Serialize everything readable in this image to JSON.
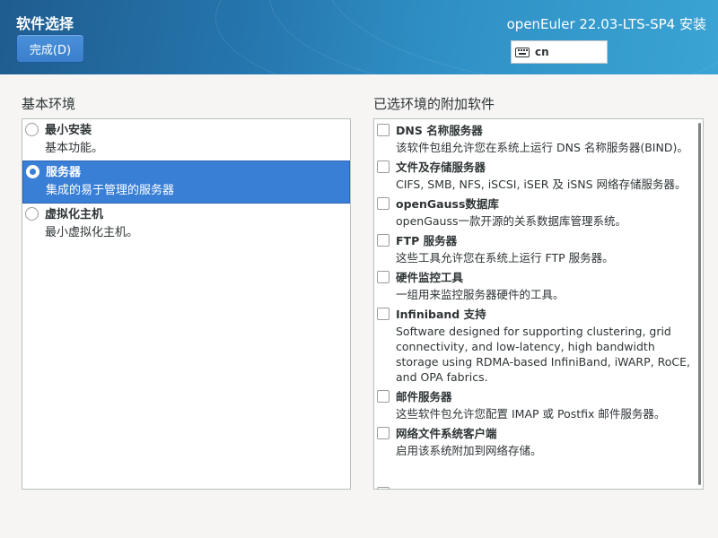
{
  "header": {
    "title": "软件选择",
    "done_label": "完成(D)",
    "product": "openEuler 22.03-LTS-SP4 安装",
    "keyboard_layout": "cn",
    "keyboard_icon": "keyboard-icon"
  },
  "base_environment": {
    "heading": "基本环境",
    "items": [
      {
        "name": "最小安装",
        "desc": "基本功能。",
        "selected": false
      },
      {
        "name": "服务器",
        "desc": "集成的易于管理的服务器",
        "selected": true
      },
      {
        "name": "虚拟化主机",
        "desc": "最小虚拟化主机。",
        "selected": false
      }
    ]
  },
  "addons": {
    "heading": "已选环境的附加软件",
    "items": [
      {
        "name": "DNS 名称服务器",
        "desc": "该软件包组允许您在系统上运行 DNS 名称服务器(BIND)。",
        "checked": false
      },
      {
        "name": "文件及存储服务器",
        "desc": "CIFS, SMB, NFS, iSCSI, iSER 及 iSNS 网络存储服务器。",
        "checked": false
      },
      {
        "name": "openGauss数据库",
        "desc": "openGauss一款开源的关系数据库管理系统。",
        "checked": false
      },
      {
        "name": "FTP 服务器",
        "desc": "这些工具允许您在系统上运行 FTP 服务器。",
        "checked": false
      },
      {
        "name": "硬件监控工具",
        "desc": "一组用来监控服务器硬件的工具。",
        "checked": false
      },
      {
        "name": "Infiniband 支持",
        "desc": "Software designed for supporting clustering, grid connectivity, and low-latency, high bandwidth storage using RDMA-based InfiniBand, iWARP, RoCE, and OPA fabrics.",
        "checked": false
      },
      {
        "name": "邮件服务器",
        "desc": "这些软件包允许您配置 IMAP 或 Postfix 邮件服务器。",
        "checked": false
      },
      {
        "name": "网络文件系统客户端",
        "desc": "启用该系统附加到网络存储。",
        "checked": false
      }
    ]
  },
  "colors": {
    "header_start": "#1f5c8f",
    "header_end": "#3aa4d4",
    "selection": "#3a7fd6"
  }
}
